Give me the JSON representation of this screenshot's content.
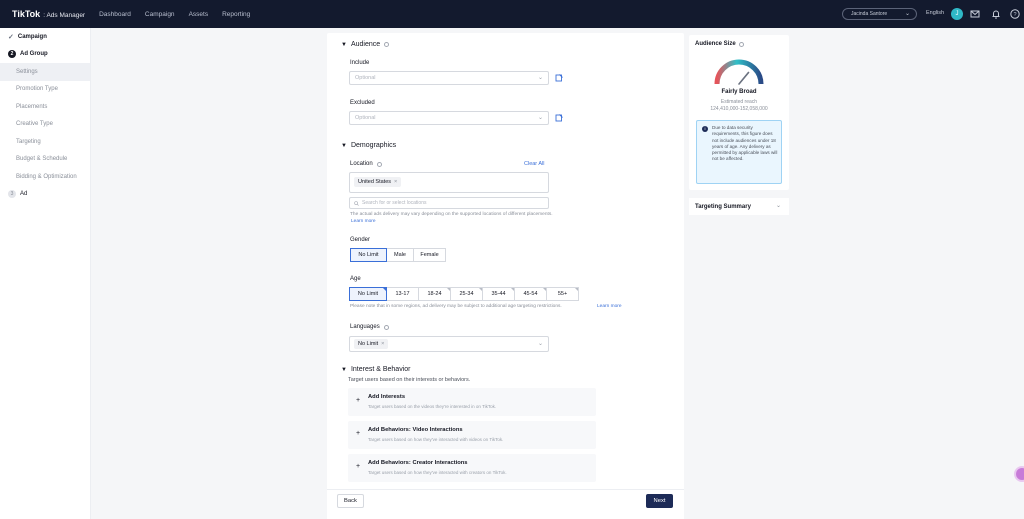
{
  "topbar": {
    "logo": "TikTok",
    "logo_sub": ": Ads Manager",
    "nav": [
      "Dashboard",
      "Campaign",
      "Assets",
      "Reporting"
    ],
    "account": "Jacinda Santore",
    "language": "English",
    "avatar": "J"
  },
  "sidebar": {
    "campaign": "Campaign",
    "ad_group": "Ad Group",
    "ad_group_step": "2",
    "sub_items": [
      "Settings",
      "Promotion Type",
      "Placements",
      "Creative Type",
      "Targeting",
      "Budget & Schedule",
      "Bidding & Optimization"
    ],
    "ad": "Ad",
    "ad_step": "3"
  },
  "audience": {
    "title": "Audience",
    "include_label": "Include",
    "include_placeholder": "Optional",
    "excluded_label": "Excluded",
    "excluded_placeholder": "Optional"
  },
  "demographics": {
    "title": "Demographics",
    "location_label": "Location",
    "clear_all": "Clear All",
    "location_tag": "United States",
    "search_placeholder": "Search for or select locations",
    "location_hint": "The actual ads delivery may vary depending on the supported locations of different placements.",
    "learn_more": "Learn more",
    "gender_label": "Gender",
    "gender_options": [
      "No Limit",
      "Male",
      "Female"
    ],
    "age_label": "Age",
    "age_options": [
      "No Limit",
      "13-17",
      "18-24",
      "25-34",
      "35-44",
      "45-54",
      "55+"
    ],
    "age_hint": "Please note that in some regions, ad delivery may be subject to additional age targeting restrictions.",
    "age_learn_more": "Learn more",
    "languages_label": "Languages",
    "languages_tag": "No Limit"
  },
  "interest": {
    "title": "Interest & Behavior",
    "subtitle": "Target users based on their interests or behaviors.",
    "cards": [
      {
        "title": "Add Interests",
        "desc": "Target users based on the videos they're interested in on TikTok."
      },
      {
        "title": "Add Behaviors: Video Interactions",
        "desc": "Target users based on how they've interacted with videos on TikTok."
      },
      {
        "title": "Add Behaviors: Creator Interactions",
        "desc": "Target users based on how they've interacted with creators on TikTok."
      }
    ]
  },
  "footer": {
    "back": "Back",
    "next": "Next"
  },
  "audience_size": {
    "title": "Audience Size",
    "status": "Fairly Broad",
    "estimated_label": "Estimated reach",
    "estimated_value": "124,410,000-152,058,000",
    "notice": "Due to data security requirements, this figure does not include audiences under 18 years of age. Any delivery as permitted by applicable laws will not be affected.",
    "gauge_level": 0.72
  },
  "targeting_summary": {
    "title": "Targeting Summary"
  }
}
